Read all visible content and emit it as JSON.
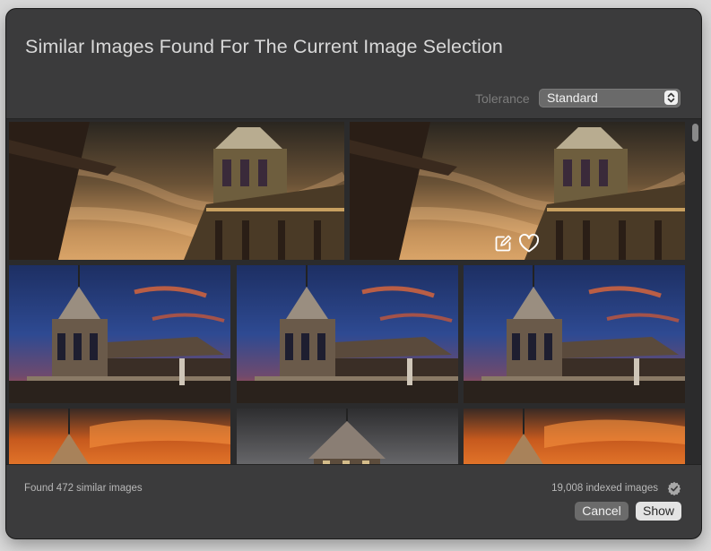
{
  "dialog": {
    "title": "Similar Images Found For The Current Image Selection",
    "tolerance": {
      "label": "Tolerance",
      "value": "Standard"
    },
    "status": {
      "found": "Found 472 similar images",
      "indexed": "19,008 indexed images"
    },
    "buttons": {
      "cancel": "Cancel",
      "show": "Show"
    }
  },
  "icons": {
    "edit": "edit-icon",
    "favorite": "heart-icon",
    "verified": "verified-badge-icon",
    "select_arrows": "up-down-chevron-icon"
  }
}
